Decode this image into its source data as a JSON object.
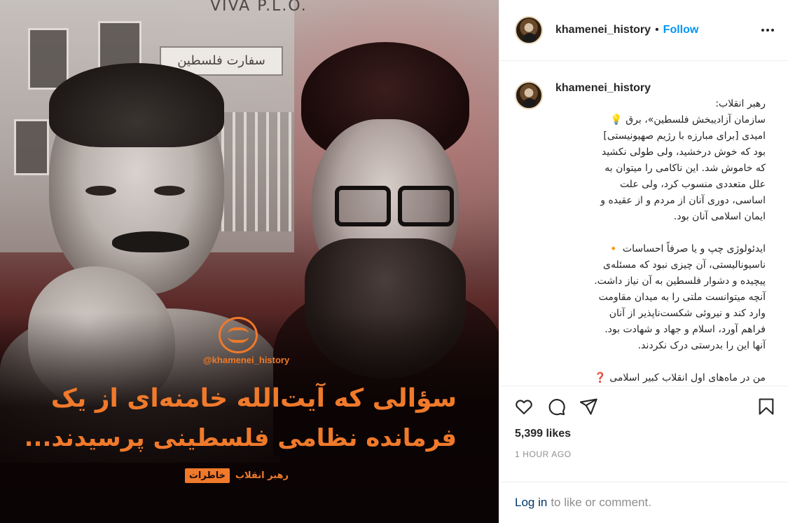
{
  "post": {
    "image": {
      "watermark_handle": "@khamenei_history",
      "headline_line1": "سؤالی که آیت‌الله خامنه‌ای از یک",
      "headline_line2": "فرمانده نظامی فلسطینی پرسیدند...",
      "tag_box": "خاطرات",
      "tag_text": "رهبر انقلاب",
      "sign_text": "سفارت فلسطین",
      "wall_text": "VIVA P.L.O."
    },
    "header": {
      "username": "khamenei_history",
      "separator": "•",
      "follow_label": "Follow",
      "more_icon": "more-horizontal-icon"
    },
    "caption": {
      "username": "khamenei_history",
      "text": "رهبر انقلاب:\nسازمان آزادیبخش فلسطین»، برق 💡\nامیدی [برای مبارزه با رژیم صهیونیستی]\nبود که خوش درخشید، ولی طولی نکشید\nکه خاموش شد. این ناکامی را میتوان به\nعلل متعددی منسوب کرد، ولی علت\nاساسی، دوری آنان از مردم و از عقیده و\nایمان اسلامی آنان بود.\n\nایدئولوژی چپ و یا صرفاً احساسات 🔸\nناسیونالیستی، آن چیزی نبود که مسئله‌ی\nپیچیده و دشوار فلسطین به آن نیاز داشت.\nآنچه میتوانست ملتی را به میدان مقاومت\nوارد کند و نیروئی شکست‌ناپذیر از آنان\nفراهم آورد، اسلام و جهاد و شهادت بود.\nآنها این را بدرستی درک نکردند.\n\nمن در ماه‌های اول انقلاب کبیر اسلامی ❓\nکه رهبران سازمان آزادیبخش فلسطین به"
    },
    "actions": {
      "like_icon": "heart-icon",
      "comment_icon": "comment-icon",
      "share_icon": "share-icon",
      "save_icon": "bookmark-icon"
    },
    "likes_text": "5,399 likes",
    "time_text": "1 HOUR AGO",
    "login": {
      "link_label": "Log in",
      "rest_text": "to like or comment."
    }
  },
  "colors": {
    "accent_orange": "#f07a2b",
    "follow_blue": "#0095f6",
    "text_dark": "#262626",
    "muted": "#8e8e8e"
  }
}
